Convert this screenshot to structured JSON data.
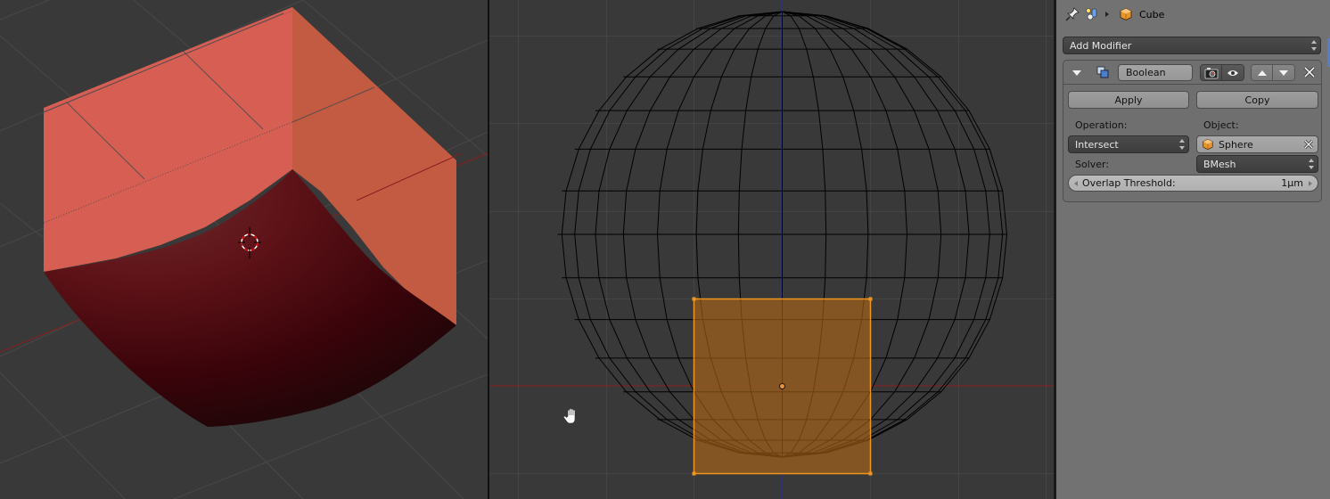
{
  "left_viewport": {
    "view": "3D perspective, solid shading",
    "object": "Cube with Boolean Intersect result",
    "colors": {
      "cube_face_light": "#d75e52",
      "cube_face_side": "#c35a42",
      "cut_surface": "#6b1216",
      "background": "#393939",
      "x_axis": "#8b1e1e"
    }
  },
  "mid_viewport": {
    "view": "front orthographic, wireframe",
    "objects": [
      "Sphere (wireframe)",
      "Cube (selected)"
    ],
    "colors": {
      "selection": "#f0961e",
      "selected_fill": "#8a5822",
      "wire": "#000000",
      "x_axis": "#8b1e1e",
      "z_axis": "#2a2ab0"
    }
  },
  "panel": {
    "breadcrumb": {
      "object_name": "Cube",
      "icons": [
        "pin-icon",
        "scene-data-icon",
        "object-cube-icon"
      ]
    },
    "add_modifier_label": "Add Modifier",
    "modifier": {
      "name": "Boolean",
      "apply_label": "Apply",
      "copy_label": "Copy",
      "operation_label": "Operation:",
      "operation_value": "Intersect",
      "object_label": "Object:",
      "object_value": "Sphere",
      "solver_label": "Solver:",
      "solver_value": "BMesh",
      "threshold_label": "Overlap Threshold:",
      "threshold_value": "1µm"
    },
    "accent": "#5680c2"
  }
}
